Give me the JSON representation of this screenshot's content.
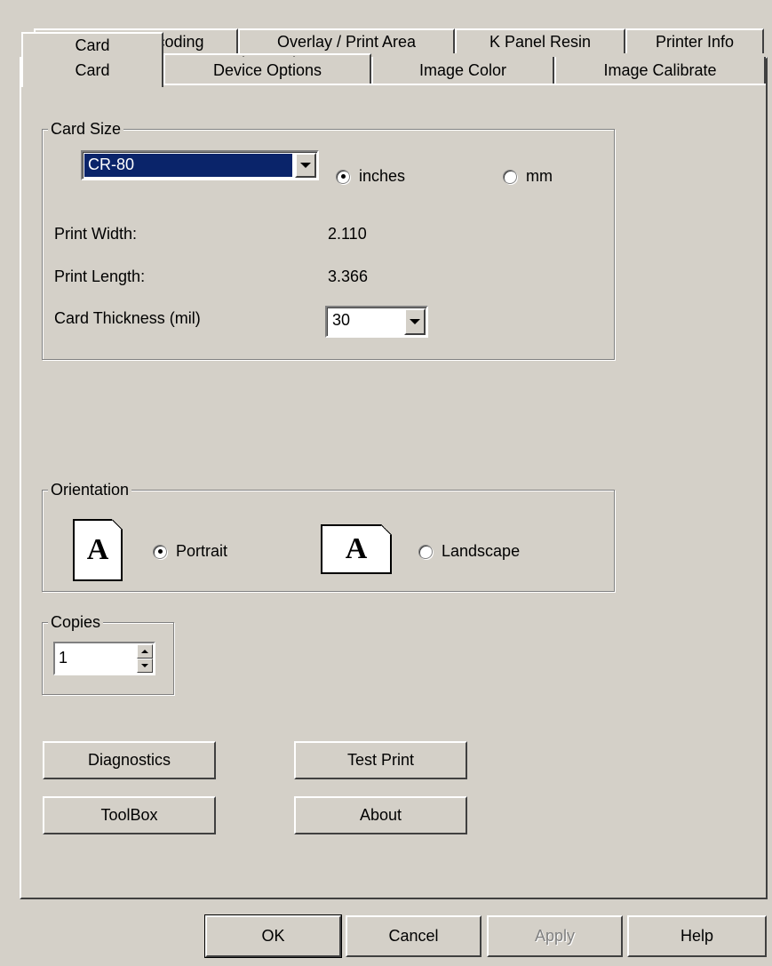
{
  "tabs": {
    "row1": [
      "Magnetic Encoding",
      "Overlay / Print Area",
      "K Panel Resin",
      "Printer Info"
    ],
    "row2": [
      "Card",
      "Device Options",
      "Image Color",
      "Image Calibrate"
    ],
    "active": "Card"
  },
  "card_size": {
    "group_title": "Card Size",
    "selected": "CR-80",
    "units": {
      "inches_label": "inches",
      "mm_label": "mm",
      "selected": "inches"
    },
    "print_width_label": "Print Width:",
    "print_width_value": "2.110",
    "print_length_label": "Print Length:",
    "print_length_value": "3.366",
    "thickness_label": "Card Thickness (mil)",
    "thickness_value": "30"
  },
  "orientation": {
    "group_title": "Orientation",
    "portrait_label": "Portrait",
    "landscape_label": "Landscape",
    "icon_letter": "A",
    "selected": "Portrait"
  },
  "copies": {
    "group_title": "Copies",
    "value": "1"
  },
  "buttons": {
    "diagnostics": "Diagnostics",
    "test_print": "Test Print",
    "toolbox": "ToolBox",
    "about": "About"
  },
  "footer": {
    "ok": "OK",
    "cancel": "Cancel",
    "apply": "Apply",
    "help": "Help"
  }
}
